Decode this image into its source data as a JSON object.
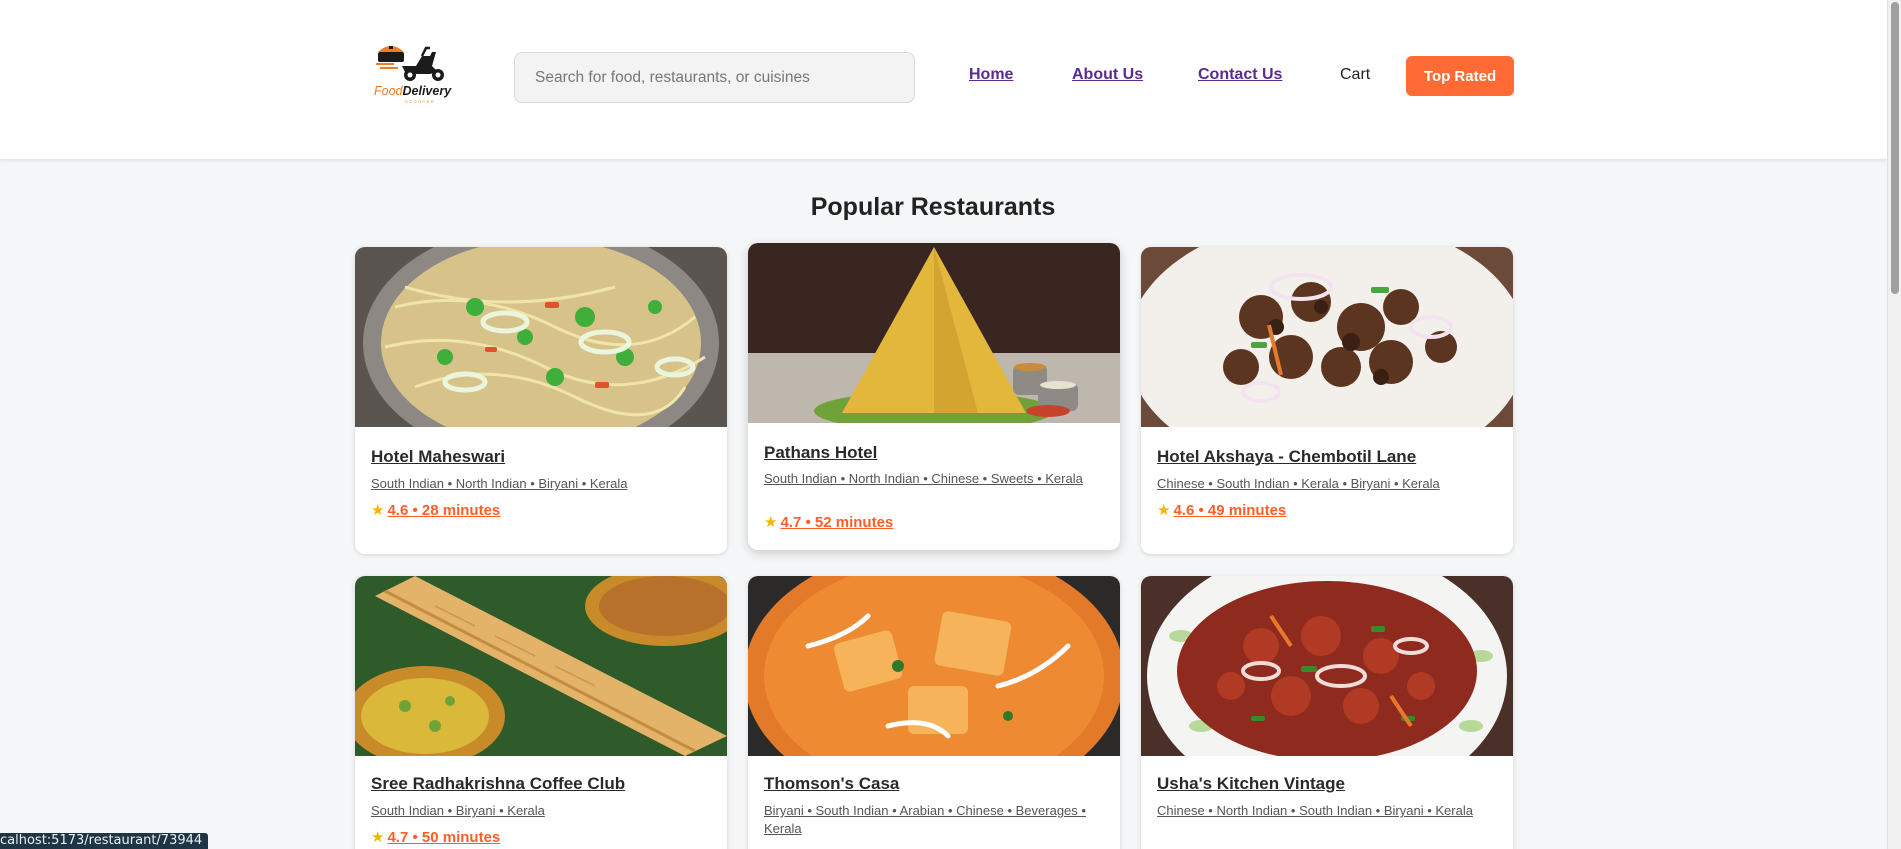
{
  "header": {
    "logo": {
      "brand_part1": "Food",
      "brand_part2": "Delivery",
      "tagline": "SCOOTER"
    },
    "search_placeholder": "Search for food, restaurants, or cuisines",
    "nav": {
      "home": "Home",
      "about": "About Us",
      "contact": "Contact Us",
      "cart": "Cart"
    },
    "top_rated_label": "Top Rated"
  },
  "section": {
    "title": "Popular Restaurants"
  },
  "restaurants": [
    {
      "name": "Hotel Maheswari",
      "cuisines": "South Indian • North Indian • Biryani • Kerala",
      "rating_text": "4.6 • 28 minutes"
    },
    {
      "name": "Pathans Hotel",
      "cuisines": "South Indian • North Indian • Chinese • Sweets • Kerala",
      "rating_text": "4.7 • 52 minutes"
    },
    {
      "name": "Hotel Akshaya - Chembotil Lane",
      "cuisines": "Chinese • South Indian • Kerala • Biryani • Kerala",
      "rating_text": "4.6 • 49 minutes"
    },
    {
      "name": "Sree Radhakrishna Coffee Club",
      "cuisines": "South Indian • Biryani • Kerala",
      "rating_text": "4.7 • 50 minutes"
    },
    {
      "name": "Thomson's Casa",
      "cuisines": "Biryani • South Indian • Arabian • Chinese • Beverages • Kerala",
      "rating_text": ""
    },
    {
      "name": "Usha's Kitchen Vintage",
      "cuisines": "Chinese • North Indian • South Indian • Biryani • Kerala",
      "rating_text": ""
    }
  ],
  "status_bar": {
    "url": "calhost:5173/restaurant/73944"
  },
  "colors": {
    "accent": "#ff6a35",
    "nav_link": "#5b2c8e",
    "rating": "#ff5e2b",
    "star": "#f5b400"
  }
}
